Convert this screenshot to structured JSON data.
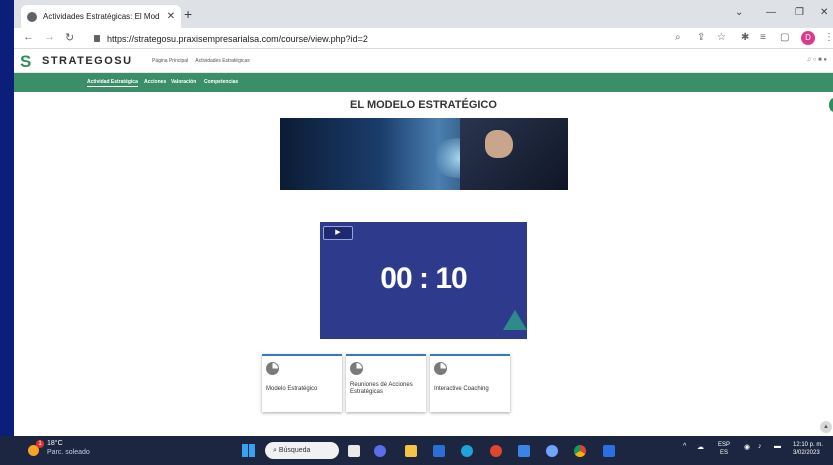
{
  "browser": {
    "tab_title": "Actividades Estratégicas: El Mod",
    "url": "https://strategosu.praxisempresarialsa.com/course/view.php?id=2",
    "profile_initial": "D"
  },
  "site": {
    "logo_mark": "S",
    "logo_text": "STRATEGOSU",
    "nav": [
      "Página Principal",
      "Actividades Estratégicas"
    ],
    "tabs": [
      "Actividad Estratégica",
      "Acciones",
      "Valoración",
      "Competencias"
    ]
  },
  "content": {
    "title": "EL MODELO ESTRATÉGICO",
    "video_timer": "00 : 10",
    "cards": [
      {
        "label": "Modelo Estratégico"
      },
      {
        "label": "Reuniones de Acciones Estratégicas"
      },
      {
        "label": "Interactive Coaching"
      }
    ]
  },
  "taskbar": {
    "weather_temp": "18°C",
    "weather_desc": "Parc. soleado",
    "weather_badge": "1",
    "search_label": "Búsqueda",
    "lang_top": "ESP",
    "lang_bottom": "ES",
    "time": "12:10 p. m.",
    "date": "3/02/2023"
  },
  "colors": {
    "brand_green": "#3b8f68",
    "video_bg": "#2e3a8c",
    "desktop_bg": "#0b1f7a"
  }
}
